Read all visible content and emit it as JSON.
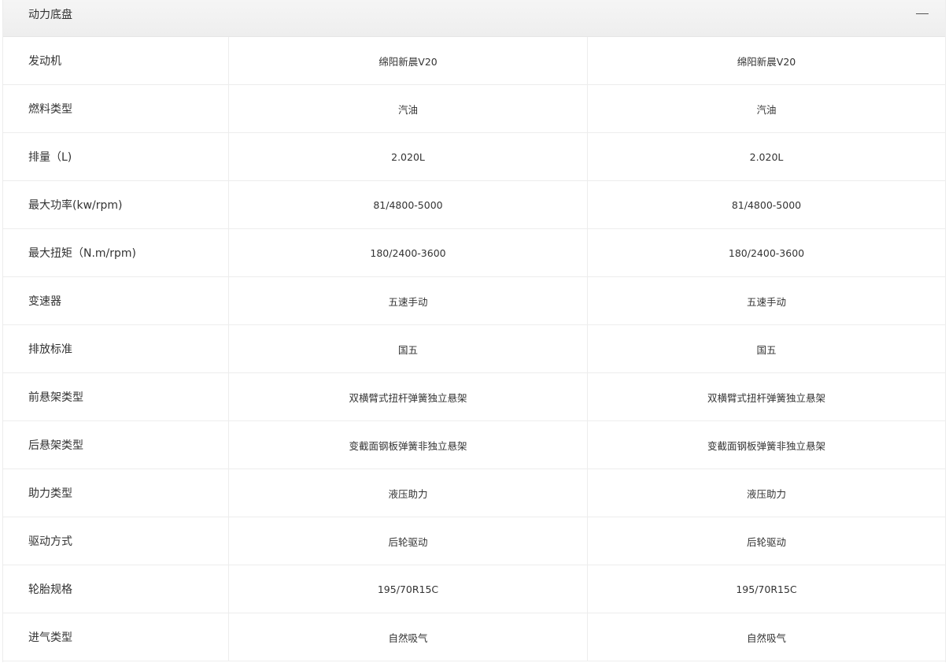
{
  "section": {
    "title": "动力底盘",
    "collapse_icon": "minus-icon"
  },
  "rows": [
    {
      "label": "发动机",
      "values": [
        "绵阳新晨V20",
        "绵阳新晨V20"
      ]
    },
    {
      "label": "燃料类型",
      "values": [
        "汽油",
        "汽油"
      ]
    },
    {
      "label": "排量（L)",
      "values": [
        "2.020L",
        "2.020L"
      ]
    },
    {
      "label": "最大功率(kw/rpm)",
      "values": [
        "81/4800-5000",
        "81/4800-5000"
      ]
    },
    {
      "label": "最大扭矩（N.m/rpm)",
      "values": [
        "180/2400-3600",
        "180/2400-3600"
      ]
    },
    {
      "label": "变速器",
      "values": [
        "五速手动",
        "五速手动"
      ]
    },
    {
      "label": "排放标准",
      "values": [
        "国五",
        "国五"
      ]
    },
    {
      "label": "前悬架类型",
      "values": [
        "双横臂式扭杆弹簧独立悬架",
        "双横臂式扭杆弹簧独立悬架"
      ]
    },
    {
      "label": "后悬架类型",
      "values": [
        "变截面钢板弹簧非独立悬架",
        "变截面钢板弹簧非独立悬架"
      ]
    },
    {
      "label": "助力类型",
      "values": [
        "液压助力",
        "液压助力"
      ]
    },
    {
      "label": "驱动方式",
      "values": [
        "后轮驱动",
        "后轮驱动"
      ]
    },
    {
      "label": "轮胎规格",
      "values": [
        "195/70R15C",
        "195/70R15C"
      ]
    },
    {
      "label": "进气类型",
      "values": [
        "自然吸气",
        "自然吸气"
      ]
    }
  ]
}
